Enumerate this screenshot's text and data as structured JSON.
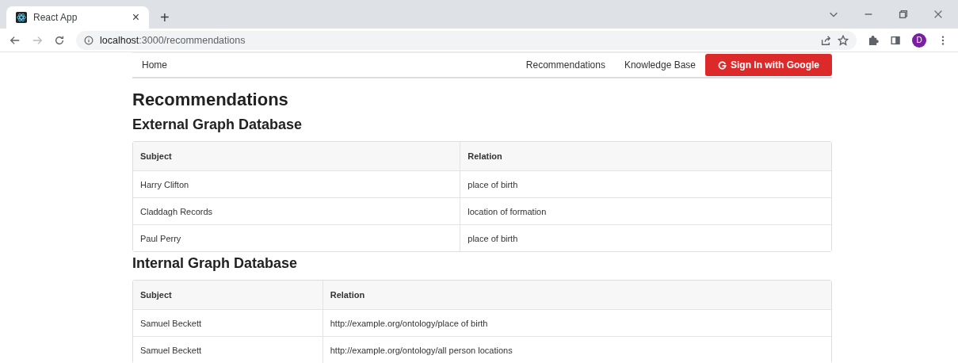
{
  "browser": {
    "tab": {
      "title": "React App",
      "close": "×"
    },
    "new_tab": "+",
    "url": {
      "host": "localhost",
      "path": ":3000/recommendations"
    },
    "profile": "D"
  },
  "nav": {
    "brand": "Home",
    "links": [
      "Recommendations",
      "Knowledge Base"
    ],
    "sign_in": "Sign In with Google"
  },
  "title": "Recommendations",
  "sections": [
    {
      "heading": "External Graph Database",
      "columns": [
        "Subject",
        "Relation"
      ],
      "rows": [
        [
          "Harry Clifton",
          "place of birth"
        ],
        [
          "Claddagh Records",
          "location of formation"
        ],
        [
          "Paul Perry",
          "place of birth"
        ]
      ]
    },
    {
      "heading": "Internal Graph Database",
      "columns": [
        "Subject",
        "Relation"
      ],
      "rows": [
        [
          "Samuel Beckett",
          "http://example.org/ontology/place of birth"
        ],
        [
          "Samuel Beckett",
          "http://example.org/ontology/all person locations"
        ]
      ]
    }
  ]
}
